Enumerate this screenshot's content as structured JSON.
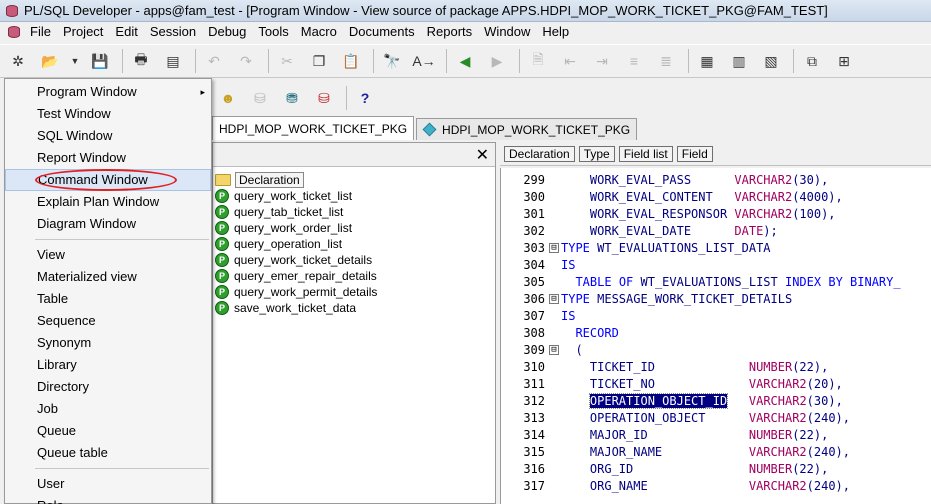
{
  "window": {
    "title": "PL/SQL Developer - apps@fam_test - [Program Window - View source of package APPS.HDPI_MOP_WORK_TICKET_PKG@FAM_TEST]"
  },
  "menubar": [
    "File",
    "Project",
    "Edit",
    "Session",
    "Debug",
    "Tools",
    "Macro",
    "Documents",
    "Reports",
    "Window",
    "Help"
  ],
  "dropdown": {
    "group1": [
      "Program Window",
      "Test Window",
      "SQL Window",
      "Report Window",
      "Command Window",
      "Explain Plan Window",
      "Diagram Window"
    ],
    "group2": [
      "View",
      "Materialized view",
      "Table",
      "Sequence",
      "Synonym",
      "Library",
      "Directory",
      "Job",
      "Queue",
      "Queue table"
    ],
    "group3": [
      "User",
      "Role"
    ],
    "submenu_arrow": "▸"
  },
  "tabs": [
    "HDPI_MOP_WORK_TICKET_PKG",
    "HDPI_MOP_WORK_TICKET_PKG"
  ],
  "toolbar2": {
    "help_glyph": "?"
  },
  "left_panel": {
    "close_glyph": "✕"
  },
  "tree": {
    "declaration": "Declaration",
    "proc_badge": "P",
    "items": [
      "query_work_ticket_list",
      "query_tab_ticket_list",
      "query_work_order_list",
      "query_operation_list",
      "query_work_ticket_details",
      "query_emer_repair_details",
      "query_work_permit_details",
      "save_work_ticket_data"
    ]
  },
  "editor_header": [
    "Declaration",
    "Type",
    "Field list",
    "Field"
  ],
  "code": {
    "fold_glyph": "⊟",
    "lines": [
      {
        "n": "299",
        "t": "    WORK_EVAL_PASS      VARCHAR2(30),"
      },
      {
        "n": "300",
        "t": "    WORK_EVAL_CONTENT   VARCHAR2(4000),"
      },
      {
        "n": "301",
        "t": "    WORK_EVAL_RESPONSOR VARCHAR2(100),"
      },
      {
        "n": "302",
        "t": "    WORK_EVAL_DATE      DATE);"
      },
      {
        "n": "303",
        "t": "TYPE WT_EVALUATIONS_LIST_DATA",
        "fold": true
      },
      {
        "n": "304",
        "t": "IS"
      },
      {
        "n": "305",
        "t": "  TABLE OF WT_EVALUATIONS_LIST INDEX BY BINARY_"
      },
      {
        "n": "306",
        "t": "TYPE MESSAGE_WORK_TICKET_DETAILS",
        "fold": true
      },
      {
        "n": "307",
        "t": "IS"
      },
      {
        "n": "308",
        "t": "  RECORD"
      },
      {
        "n": "309",
        "t": "  (",
        "fold": true
      },
      {
        "n": "310",
        "t": "    TICKET_ID             NUMBER(22),"
      },
      {
        "n": "311",
        "t": "    TICKET_NO             VARCHAR2(20),"
      },
      {
        "n": "312",
        "t": "    OPERATION_OBJECT_ID   VARCHAR2(30),"
      },
      {
        "n": "313",
        "t": "    OPERATION_OBJECT      VARCHAR2(240),"
      },
      {
        "n": "314",
        "t": "    MAJOR_ID              NUMBER(22),"
      },
      {
        "n": "315",
        "t": "    MAJOR_NAME            VARCHAR2(240),"
      },
      {
        "n": "316",
        "t": "    ORG_ID                NUMBER(22),"
      },
      {
        "n": "317",
        "t": "    ORG_NAME              VARCHAR2(240),"
      }
    ]
  }
}
